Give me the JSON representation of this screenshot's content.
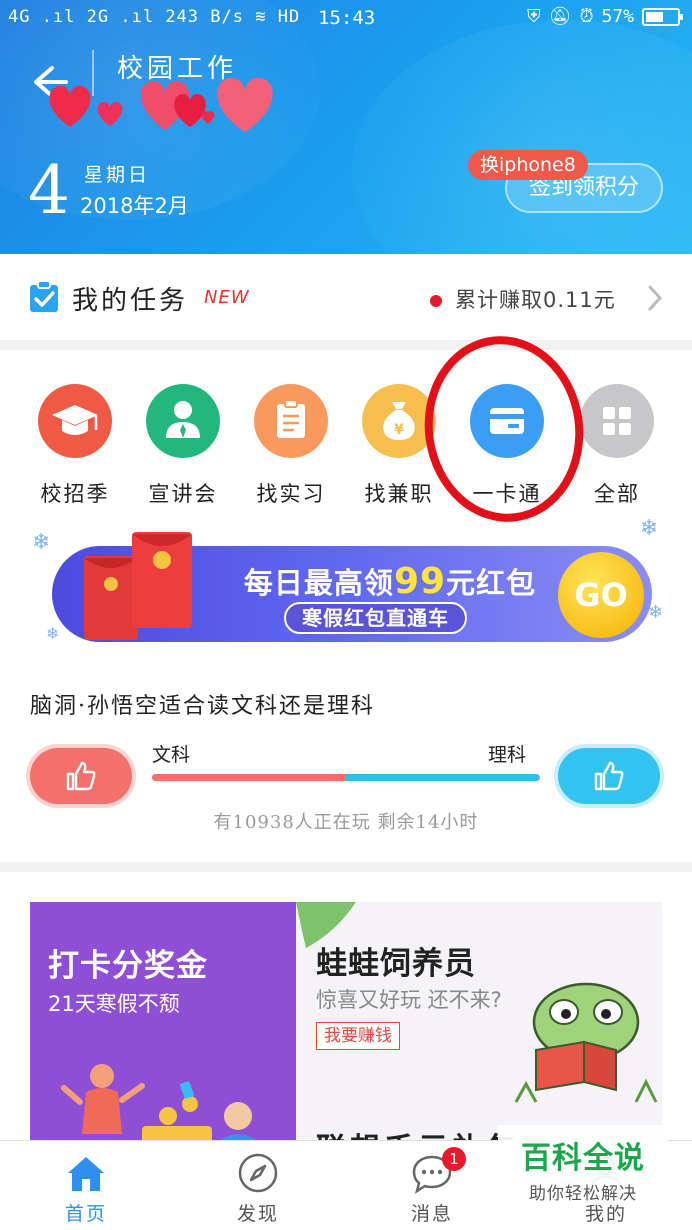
{
  "status_bar": {
    "signal": "4G .ıl 2G .ıl",
    "speed": "243 B/s",
    "network_extra": "HD",
    "time": "15:43",
    "battery": "57%",
    "battery_level": 0.57
  },
  "header": {
    "title": "校园工作",
    "date": {
      "day": "4",
      "weekday": "星期日",
      "month": "2018年2月"
    },
    "signin_label": "签到领积分",
    "badge": "换iphone8"
  },
  "task": {
    "title": "我的任务",
    "new_tag": "NEW",
    "earned": "累计赚取0.11元"
  },
  "quick_links": [
    {
      "label": "校招季",
      "icon": "graduation-cap-icon",
      "color": "#ef5a46"
    },
    {
      "label": "宣讲会",
      "icon": "speaker-person-icon",
      "color": "#23b77f"
    },
    {
      "label": "找实习",
      "icon": "clipboard-icon",
      "color": "#f89a5d"
    },
    {
      "label": "找兼职",
      "icon": "money-bag-icon",
      "color": "#f6be4f"
    },
    {
      "label": "一卡通",
      "icon": "card-icon",
      "color": "#3b9ef5"
    },
    {
      "label": "全部",
      "icon": "grid-icon",
      "color": "#c7c7c9"
    }
  ],
  "banner": {
    "title_pre": "每日最高领",
    "title_num": "99",
    "title_post": "元红包",
    "subtitle": "寒假红包直通车",
    "go": "GO"
  },
  "quiz": {
    "question": "脑洞·孙悟空适合读文科还是理科",
    "option_left": "文科",
    "option_right": "理科",
    "left_share": 0.5,
    "meta": "有10938人正在玩 剩余14小时"
  },
  "promo": {
    "left_title": "打卡分奖金",
    "left_sub": "21天寒假不颓",
    "right_title": "蛙蛙饲养员",
    "right_sub": "惊喜又好玩 还不来?",
    "right_button": "我要赚钱",
    "right_more": "联想千元礼包"
  },
  "tabs": [
    {
      "label": "首页",
      "icon": "home-icon"
    },
    {
      "label": "发现",
      "icon": "compass-icon"
    },
    {
      "label": "消息",
      "icon": "chat-icon",
      "badge": "1"
    },
    {
      "label": "我的",
      "icon": "person-icon"
    }
  ],
  "watermark": {
    "title": "百科全说",
    "subtitle": "助你轻松解决"
  },
  "colors": {
    "header_blue": "#1a8fe8",
    "accent_red": "#e8192c",
    "active_tab": "#2d8ff0"
  }
}
